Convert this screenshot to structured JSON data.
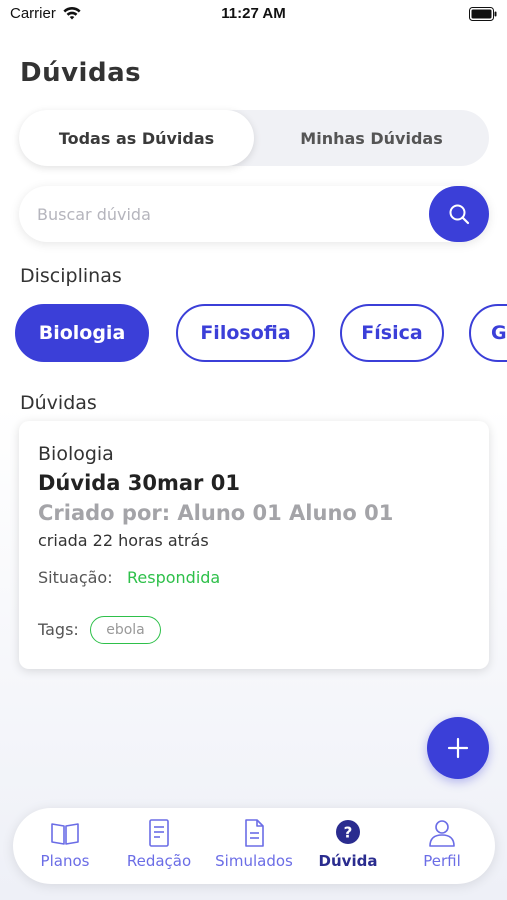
{
  "status_bar": {
    "carrier": "Carrier",
    "time": "11:27 AM"
  },
  "page": {
    "title": "Dúvidas"
  },
  "segment": {
    "tabs": [
      {
        "label": "Todas as Dúvidas",
        "active": true
      },
      {
        "label": "Minhas Dúvidas",
        "active": false
      }
    ]
  },
  "search": {
    "placeholder": "Buscar dúvida",
    "value": ""
  },
  "disciplines": {
    "label": "Disciplinas",
    "items": [
      "Biologia",
      "Filosofia",
      "Física",
      "G"
    ],
    "selected": "Biologia"
  },
  "questions": {
    "label": "Dúvidas",
    "items": [
      {
        "subject": "Biologia",
        "title": "Dúvida 30mar 01",
        "author": "Criado por: Aluno 01 Aluno 01",
        "time": "criada 22 horas atrás",
        "status_label": "Situação:",
        "status_value": "Respondida",
        "tags_label": "Tags:",
        "tags": [
          "ebola"
        ]
      }
    ]
  },
  "tab_bar": {
    "items": [
      {
        "label": "Planos",
        "icon": "book-icon"
      },
      {
        "label": "Redação",
        "icon": "document-icon"
      },
      {
        "label": "Simulados",
        "icon": "file-text-icon"
      },
      {
        "label": "Dúvida",
        "icon": "question-circle-icon",
        "active": true
      },
      {
        "label": "Perfil",
        "icon": "user-icon"
      }
    ]
  },
  "colors": {
    "accent": "#3b3fd8",
    "success": "#2ec04a",
    "muted": "#a4a4a8"
  }
}
